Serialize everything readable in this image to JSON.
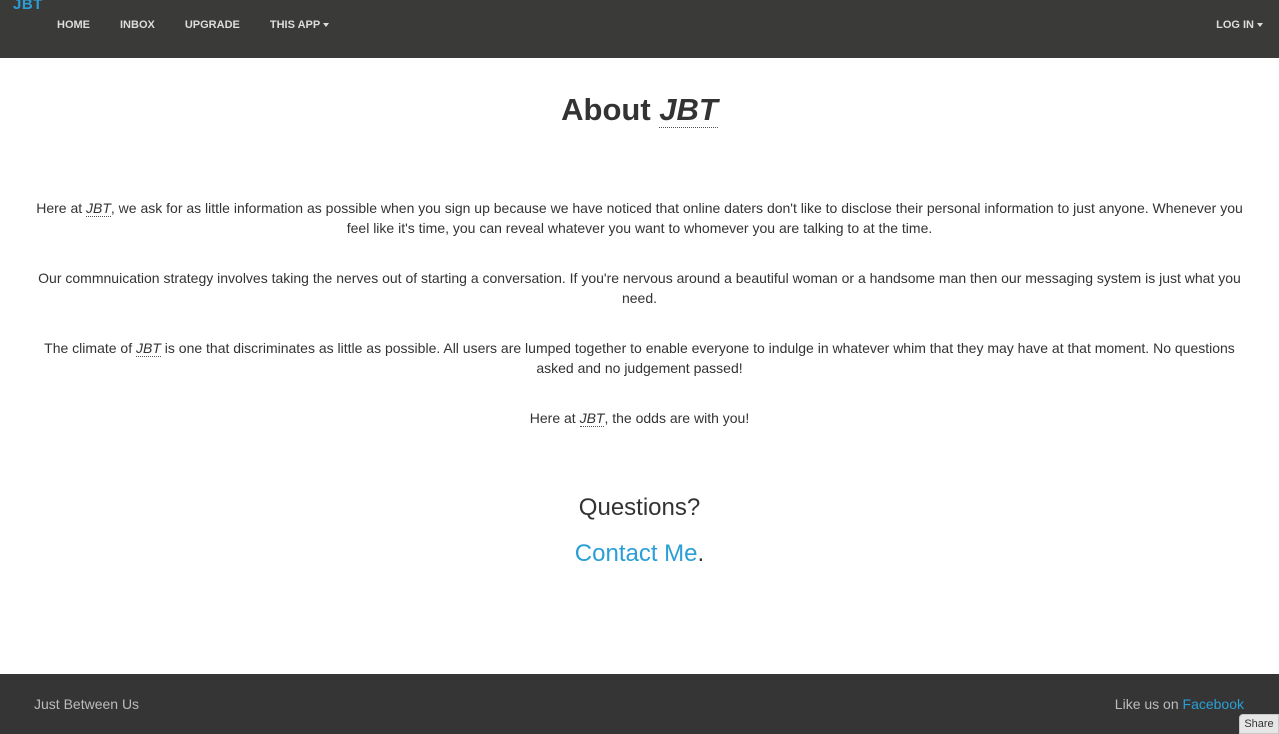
{
  "navbar": {
    "brand": "JBT",
    "links": [
      {
        "label": "HOME"
      },
      {
        "label": "INBOX"
      },
      {
        "label": "UPGRADE"
      },
      {
        "label": "THIS APP"
      }
    ],
    "login_label": "LOG IN"
  },
  "main": {
    "title_prefix": "About ",
    "title_abbr": "JBT",
    "para1": {
      "before": "Here at ",
      "abbr": "JBT",
      "after": ", we ask for as little information as possible when you sign up because we have noticed that online daters don't like to disclose their personal information to just anyone. Whenever you feel like it's time, you can reveal whatever you want to whomever you are talking to at the time."
    },
    "para2": "Our commnuication strategy involves taking the nerves out of starting a conversation. If you're nervous around a beautiful woman or a handsome man then our messaging system is just what you need.",
    "para3": {
      "before": "The climate of ",
      "abbr": "JBT",
      "after": " is one that discriminates as little as possible. All users are lumped together to enable everyone to indulge in whatever whim that they may have at that moment. No questions asked and no judgement passed!"
    },
    "para4": {
      "before": "Here at ",
      "abbr": "JBT",
      "after": ", the odds are with you!"
    },
    "questions_heading": "Questions?",
    "contact_link": "Contact Me",
    "contact_suffix": "."
  },
  "footer": {
    "left_text": "Just Between Us",
    "right_prefix": "Like us on ",
    "right_link": "Facebook"
  },
  "share_label": "Share",
  "colors": {
    "accent": "#2a9fd6",
    "navbar_bg": "#3a3a38",
    "footer_bg": "#353535"
  }
}
